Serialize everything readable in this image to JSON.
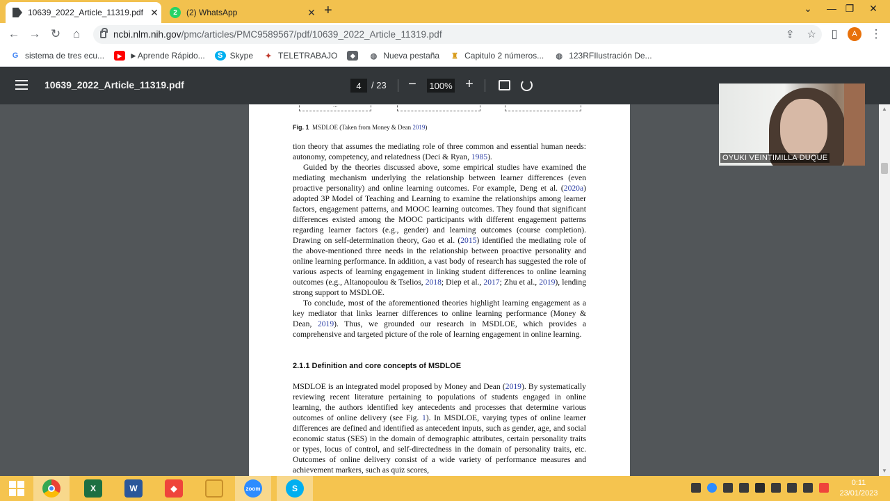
{
  "browser": {
    "tabs": [
      {
        "title": "10639_2022_Article_11319.pdf",
        "active": true
      },
      {
        "title": "(2) WhatsApp",
        "badge": "2",
        "active": false
      }
    ],
    "url": {
      "domain": "ncbi.nlm.nih.gov",
      "path": "/pmc/articles/PMC9589567/pdf/10639_2022_Article_11319.pdf"
    },
    "profile_initial": "A",
    "bookmarks": [
      {
        "label": "sistema de tres ecu...",
        "icon": "google-icon"
      },
      {
        "label": "►Aprende Rápido...",
        "icon": "youtube-icon"
      },
      {
        "label": "Skype",
        "icon": "skype-icon"
      },
      {
        "label": "TELETRABAJO",
        "icon": "teletrabajo-icon"
      },
      {
        "label": "",
        "icon": "folder-bookmark-icon"
      },
      {
        "label": "Nueva pestaña",
        "icon": "globe-icon"
      },
      {
        "label": "Capitulo 2 números...",
        "icon": "bookmark-page-icon"
      },
      {
        "label": "123RFIlustración De...",
        "icon": "globe-icon"
      }
    ]
  },
  "pdf_viewer": {
    "title": "10639_2022_Article_11319.pdf",
    "current_page": "4",
    "total_pages": "/ 23",
    "zoom": "100%"
  },
  "page_content": {
    "top_fragment": "...",
    "figure_caption": {
      "label": "Fig. 1",
      "text": "MSDLOE (Taken from Money & Dean ",
      "year": "2019",
      "close": ")"
    },
    "section_heading": "2.1.1  Definition and core concepts of MSDLOE"
  },
  "webcam": {
    "name": "OYUKI VEINTIMILLA DUQUE"
  },
  "taskbar": {
    "apps": [
      "start",
      "chrome",
      "excel",
      "word",
      "anydesk",
      "file-explorer",
      "zoom",
      "skype"
    ],
    "time": "0:11",
    "date": "23/01/2023"
  },
  "colors": {
    "accent_yellow": "#f2c14e",
    "pdf_toolbar": "#323639",
    "link_blue": "#2b3ea4"
  }
}
